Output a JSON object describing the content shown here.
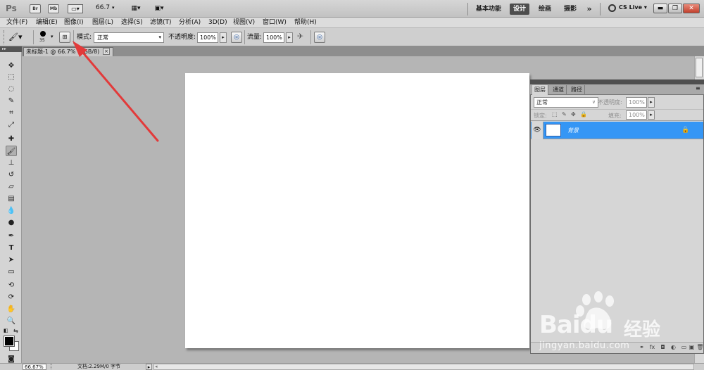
{
  "appbar": {
    "logo": "Ps",
    "bridge": "Br",
    "minibridge": "Mb",
    "zoom": "66.7",
    "workspaces": [
      "基本功能",
      "设计",
      "绘画",
      "摄影"
    ],
    "active_workspace": "设计",
    "more": "»",
    "cslive": "CS Live"
  },
  "menu": [
    "文件(F)",
    "编辑(E)",
    "图像(I)",
    "图层(L)",
    "选择(S)",
    "滤镜(T)",
    "分析(A)",
    "3D(D)",
    "视图(V)",
    "窗口(W)",
    "帮助(H)"
  ],
  "options": {
    "brush_size": "35",
    "mode_label": "模式:",
    "mode_value": "正常",
    "opacity_label": "不透明度:",
    "opacity_value": "100%",
    "flow_label": "流量:",
    "flow_value": "100%"
  },
  "document": {
    "tab_label": "未标题-1 @ 66.7% (RGB/8)",
    "close": "×"
  },
  "layers_panel": {
    "tabs": [
      "图层",
      "通道",
      "路径"
    ],
    "blend_mode": "正常",
    "opacity_label": "不透明度:",
    "opacity_value": "100%",
    "lock_label": "锁定:",
    "fill_label": "填充:",
    "fill_value": "100%",
    "layer_name": "背景"
  },
  "statusbar": {
    "zoom": "66.67%",
    "doc_info": "文档:2.29M/0 字节"
  },
  "watermark": {
    "brand": "Baidu",
    "brand_cn": "经验",
    "url": "jingyan.baidu.com"
  },
  "colors": {
    "accent_blue": "#3596f5",
    "annotation_red": "#e23a3a"
  }
}
